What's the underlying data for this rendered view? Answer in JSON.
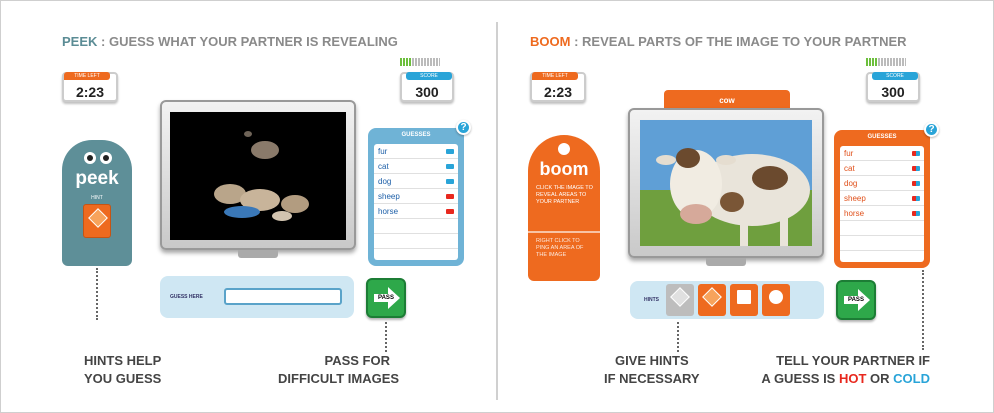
{
  "peek": {
    "heading_keyword": "PEEK",
    "heading_rest": " : GUESS WHAT YOUR PARTNER IS REVEALING",
    "time_left_label": "TIME LEFT",
    "time_left": "2:23",
    "score_label": "SCORE",
    "score": "300",
    "meter_level_fraction": 0.3,
    "badge_word": "peek",
    "hint_label": "HINT",
    "guesses_title": "GUESSES",
    "guesses": [
      "fur",
      "cat",
      "dog",
      "sheep",
      "horse"
    ],
    "guess_marks": [
      "cold",
      "cold",
      "cold",
      "hot",
      "hot"
    ],
    "guess_input_label": "GUESS HERE",
    "guess_input_value": "",
    "pass_label": "PASS",
    "caption_left": [
      "HINTS HELP",
      "YOU GUESS"
    ],
    "caption_right": [
      "PASS FOR",
      "DIFFICULT IMAGES"
    ]
  },
  "boom": {
    "heading_keyword": "BOOM",
    "heading_rest": " : REVEAL PARTS OF THE IMAGE TO YOUR PARTNER",
    "time_left_label": "TIME LEFT",
    "time_left": "2:23",
    "score_label": "SCORE",
    "score": "300",
    "meter_level_fraction": 0.3,
    "image_word": "cow",
    "badge_word": "boom",
    "badge_desc": "CLICK THE IMAGE TO REVEAL AREAS TO YOUR PARTNER",
    "badge_desc2": "RIGHT CLICK TO PING AN AREA OF THE IMAGE",
    "guesses_title": "GUESSES",
    "guesses": [
      "fur",
      "cat",
      "dog",
      "sheep",
      "horse"
    ],
    "hints_label": "HINTS",
    "pass_label": "PASS",
    "caption_left": [
      "GIVE HINTS",
      "IF NECESSARY"
    ],
    "caption_right_1": "TELL YOUR PARTNER IF",
    "caption_right_2a": "A GUESS IS ",
    "caption_hot": "HOT",
    "caption_or": " OR ",
    "caption_cold": "COLD"
  },
  "colors": {
    "orange": "#ee6a1f",
    "teal": "#5e8f98",
    "blue": "#29a4d8",
    "green": "#2ea84a",
    "hot": "#e8281e",
    "cold": "#29a4d8"
  }
}
